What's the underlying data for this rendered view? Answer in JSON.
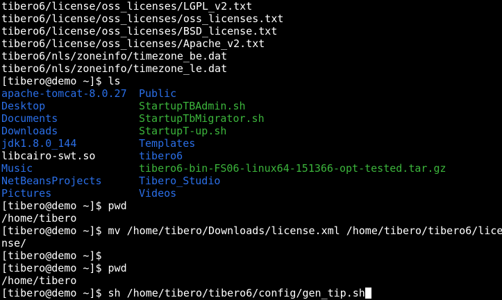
{
  "colors": {
    "background": "#000000",
    "text": "#ffffff",
    "directory": "#2b6fe8",
    "executable": "#3cb63c"
  },
  "output_before": [
    "tibero6/license/oss_licenses/LGPL_v2.txt",
    "tibero6/license/oss_licenses/oss_licenses.txt",
    "tibero6/license/oss_licenses/BSD_license.txt",
    "tibero6/license/oss_licenses/Apache_v2.txt",
    "tibero6/nls/zoneinfo/timezone_be.dat",
    "tibero6/nls/zoneinfo/timezone_le.dat"
  ],
  "cmd_ls": "[tibero@demo ~]$ ls",
  "ls_rows": [
    {
      "left": {
        "text": "apache-tomcat-8.0.27",
        "kind": "dir"
      },
      "right": {
        "text": "Public",
        "kind": "dir"
      }
    },
    {
      "left": {
        "text": "Desktop",
        "kind": "dir"
      },
      "right": {
        "text": "StartupTBAdmin.sh",
        "kind": "exe"
      }
    },
    {
      "left": {
        "text": "Documents",
        "kind": "dir"
      },
      "right": {
        "text": "StartupTbMigrator.sh",
        "kind": "exe"
      }
    },
    {
      "left": {
        "text": "Downloads",
        "kind": "dir"
      },
      "right": {
        "text": "StartupT-up.sh",
        "kind": "exe"
      }
    },
    {
      "left": {
        "text": "jdk1.8.0_144",
        "kind": "dir"
      },
      "right": {
        "text": "Templates",
        "kind": "dir"
      }
    },
    {
      "left": {
        "text": "libcairo-swt.so",
        "kind": "plain"
      },
      "right": {
        "text": "tibero6",
        "kind": "dir"
      }
    },
    {
      "left": {
        "text": "Music",
        "kind": "dir"
      },
      "right": {
        "text": "tibero6-bin-FS06-linux64-151366-opt-tested.tar.gz",
        "kind": "exe"
      }
    },
    {
      "left": {
        "text": "NetBeansProjects",
        "kind": "dir"
      },
      "right": {
        "text": "Tibero_Studio",
        "kind": "dir"
      }
    },
    {
      "left": {
        "text": "Pictures",
        "kind": "dir"
      },
      "right": {
        "text": "Videos",
        "kind": "dir"
      }
    }
  ],
  "output_after": [
    "[tibero@demo ~]$ pwd",
    "/home/tibero",
    "[tibero@demo ~]$ mv /home/tibero/Downloads/license.xml /home/tibero/tibero6/lice",
    "nse/",
    "[tibero@demo ~]$",
    "[tibero@demo ~]$ pwd",
    "/home/tibero"
  ],
  "current_command": "[tibero@demo ~]$ sh /home/tibero/tibero6/config/gen_tip.sh"
}
